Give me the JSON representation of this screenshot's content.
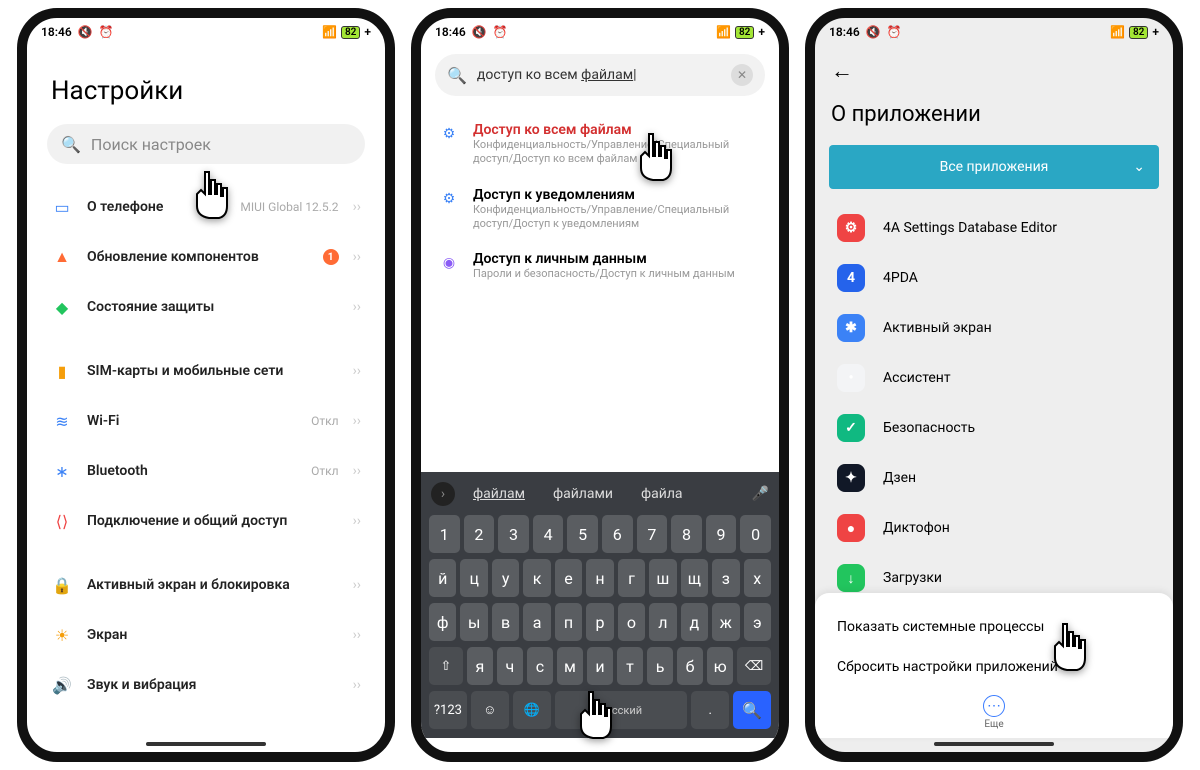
{
  "statusbar": {
    "time": "18:46",
    "battery_icon": "82",
    "extra": "+"
  },
  "screen1": {
    "title": "Настройки",
    "search_placeholder": "Поиск настроек",
    "items": [
      {
        "id": "about",
        "label": "О телефоне",
        "trail": "MIUI Global 12.5.2",
        "color": "#3b82f6",
        "glyph": "▭"
      },
      {
        "id": "update",
        "label": "Обновление компонентов",
        "badge": "1",
        "color": "#ff6b35",
        "glyph": "▲"
      },
      {
        "id": "security",
        "label": "Состояние защиты",
        "color": "#22c55e",
        "glyph": "◆"
      },
      {
        "gap": true
      },
      {
        "id": "sim",
        "label": "SIM-карты и мобильные сети",
        "color": "#f59e0b",
        "glyph": "▮"
      },
      {
        "id": "wifi",
        "label": "Wi-Fi",
        "trail": "Откл",
        "color": "#3b82f6",
        "glyph": "≋"
      },
      {
        "id": "bt",
        "label": "Bluetooth",
        "trail": "Откл",
        "color": "#3b82f6",
        "glyph": "∗"
      },
      {
        "id": "share",
        "label": "Подключение и общий доступ",
        "color": "#ef4444",
        "glyph": "⟨⟩"
      },
      {
        "gap": true
      },
      {
        "id": "lock",
        "label": "Активный экран и блокировка",
        "color": "#ef4444",
        "glyph": "🔒"
      },
      {
        "id": "display",
        "label": "Экран",
        "color": "#f59e0b",
        "glyph": "☀"
      },
      {
        "id": "sound",
        "label": "Звук и вибрация",
        "color": "#22c55e",
        "glyph": "🔊"
      }
    ]
  },
  "screen2": {
    "search_value": "доступ ко всем файлам",
    "results": [
      {
        "title": "Доступ ко всем файлам",
        "sub": "Конфиденциальность/Управление/Специальный доступ/Доступ ко всем файлам",
        "red": true,
        "icon_color": "#3b82f6",
        "glyph": "⚙"
      },
      {
        "title": "Доступ к уведомлениям",
        "sub": "Конфиденциальность/Управление/Специальный доступ/Доступ к уведомлениям",
        "icon_color": "#3b82f6",
        "glyph": "⚙"
      },
      {
        "title": "Доступ к личным данным",
        "sub": "Пароли и безопасность/Доступ к личным данным",
        "icon_color": "#8b5cf6",
        "glyph": "◉"
      }
    ],
    "suggestions": [
      "файлам",
      "файлами",
      "файла"
    ],
    "space_label": "Русский",
    "sym_label": "?123",
    "rows": [
      [
        "1",
        "2",
        "3",
        "4",
        "5",
        "6",
        "7",
        "8",
        "9",
        "0"
      ],
      [
        "й",
        "ц",
        "у",
        "к",
        "е",
        "н",
        "г",
        "ш",
        "щ",
        "з",
        "х"
      ],
      [
        "ф",
        "ы",
        "в",
        "а",
        "п",
        "р",
        "о",
        "л",
        "д",
        "ж",
        "э"
      ],
      [
        "я",
        "ч",
        "с",
        "м",
        "и",
        "т",
        "ь",
        "б",
        "ю"
      ]
    ]
  },
  "screen3": {
    "title": "О приложении",
    "dropdown": "Все приложения",
    "apps": [
      {
        "name": "4A Settings Database Editor",
        "bg": "#ef4444",
        "glyph": "⚙"
      },
      {
        "name": "4PDA",
        "bg": "#2563eb",
        "glyph": "4"
      },
      {
        "name": "Активный экран",
        "bg": "#3b82f6",
        "glyph": "✱"
      },
      {
        "name": "Ассистент",
        "bg": "#f3f4f6",
        "glyph": "•"
      },
      {
        "name": "Безопасность",
        "bg": "#10b981",
        "glyph": "✓"
      },
      {
        "name": "Дзен",
        "bg": "#111827",
        "glyph": "✦"
      },
      {
        "name": "Диктофон",
        "bg": "#ef4444",
        "glyph": "●"
      },
      {
        "name": "Загрузки",
        "bg": "#22c55e",
        "glyph": "↓"
      }
    ],
    "menu": [
      "Показать системные процессы",
      "Сбросить настройки приложений"
    ],
    "more_label": "Еще"
  }
}
